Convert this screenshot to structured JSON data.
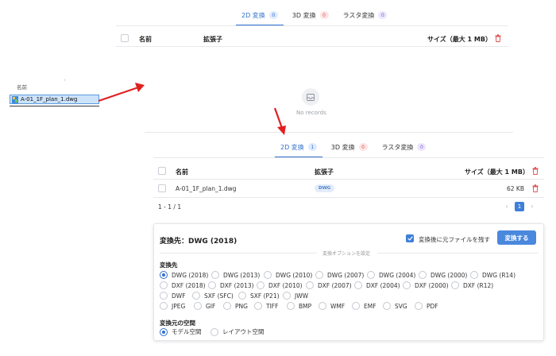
{
  "top": {
    "tabs": [
      {
        "label": "2D 変換",
        "count": "0"
      },
      {
        "label": "3D 変換",
        "count": "0"
      },
      {
        "label": "ラスタ変換",
        "count": "0"
      }
    ],
    "columns": {
      "name": "名前",
      "ext": "拡張子",
      "size": "サイズ（最大 1 MB）"
    },
    "empty_text": "No records"
  },
  "explorer": {
    "header": "名前",
    "file_name": "A-01_1F_plan_1.dwg"
  },
  "bottom": {
    "tabs": [
      {
        "label": "2D 変換",
        "count": "1"
      },
      {
        "label": "3D 変換",
        "count": "0"
      },
      {
        "label": "ラスタ変換",
        "count": "0"
      }
    ],
    "columns": {
      "name": "名前",
      "ext": "拡張子",
      "size": "サイズ（最大 1 MB）"
    },
    "rows": [
      {
        "name": "A-01_1F_plan_1.dwg",
        "ext": "DWG",
        "size": "62 KB"
      }
    ],
    "pagination": {
      "range": "1 - 1 / 1",
      "prev": "‹",
      "page": "1",
      "next": "›"
    }
  },
  "panel": {
    "title": "変換先：DWG (2018)",
    "keep_original_label": "変換後に元ファイルを残す",
    "convert_button": "変換する",
    "options_divider": "変換オプションを設定",
    "target_label": "変換先",
    "formats": [
      [
        "DWG (2018)",
        "DWG (2013)",
        "DWG (2010)",
        "DWG (2007)",
        "DWG (2004)",
        "DWG (2000)",
        "DWG (R14)"
      ],
      [
        "DXF (2018)",
        "DXF (2013)",
        "DXF (2010)",
        "DXF (2007)",
        "DXF (2004)",
        "DXF (2000)",
        "DXF (R12)"
      ],
      [
        "DWF",
        "SXF (SFC)",
        "SXF (P21)",
        "JWW"
      ],
      [
        "JPEG",
        "GIF",
        "PNG",
        "TIFF",
        "BMP",
        "WMF",
        "EMF",
        "SVG",
        "PDF"
      ]
    ],
    "space_label": "変換元の空間",
    "spaces": [
      "モデル空間",
      "レイアウト空間"
    ]
  },
  "colors": {
    "accent": "#2f6fd0",
    "arrow": "#e02020",
    "delete": "#e05555"
  }
}
